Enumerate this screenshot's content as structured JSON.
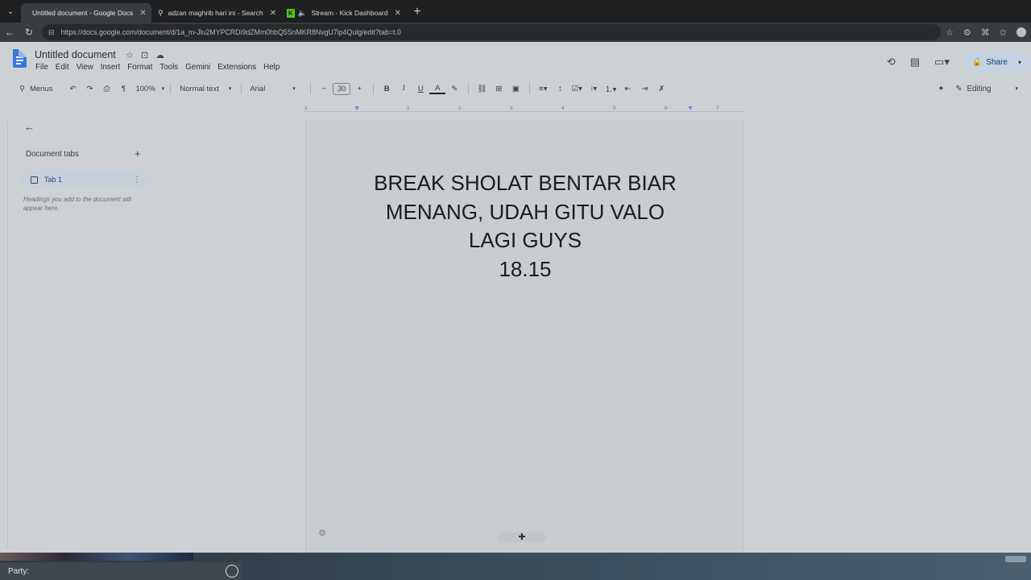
{
  "browser": {
    "tabs": [
      {
        "title": "Untitled document - Google Docs",
        "active": true,
        "icon": "docs-icon"
      },
      {
        "title": "adzan maghrib hari ini - Search",
        "active": false,
        "icon": "search-icon"
      },
      {
        "title": "Stream - Kick Dashboard",
        "active": false,
        "icon": "kick-icon"
      }
    ],
    "url": "https://docs.google.com/document/d/1a_m-Jlu2MYPCRDi9dZMm0hbQ5SnMKR8NvgU7ip4Qulg/edit?tab=t.0"
  },
  "docs": {
    "title": "Untitled document",
    "menu": [
      "File",
      "Edit",
      "View",
      "Insert",
      "Format",
      "Tools",
      "Gemini",
      "Extensions",
      "Help"
    ],
    "share_label": "Share",
    "toolbar": {
      "menus_label": "Menus",
      "zoom": "100%",
      "style": "Normal text",
      "font": "Arial",
      "font_size": "30",
      "mode": "Editing"
    },
    "ruler_ticks": [
      "1",
      "1",
      "2",
      "3",
      "4",
      "5",
      "6",
      "7"
    ]
  },
  "sidebar": {
    "title": "Document tabs",
    "tab_label": "Tab 1",
    "hint": "Headings you add to the document will appear here."
  },
  "document": {
    "lines": [
      "BREAK SHOLAT BENTAR BIAR",
      "MENANG, UDAH GITU VALO",
      "LAGI GUYS",
      "18.15"
    ]
  },
  "taskbar": {
    "party_label": "Party:"
  },
  "colors": {
    "docs_blue": "#3b76d8",
    "share_bg": "#c3d3e4",
    "tab_highlight": "#c7d0d9"
  }
}
